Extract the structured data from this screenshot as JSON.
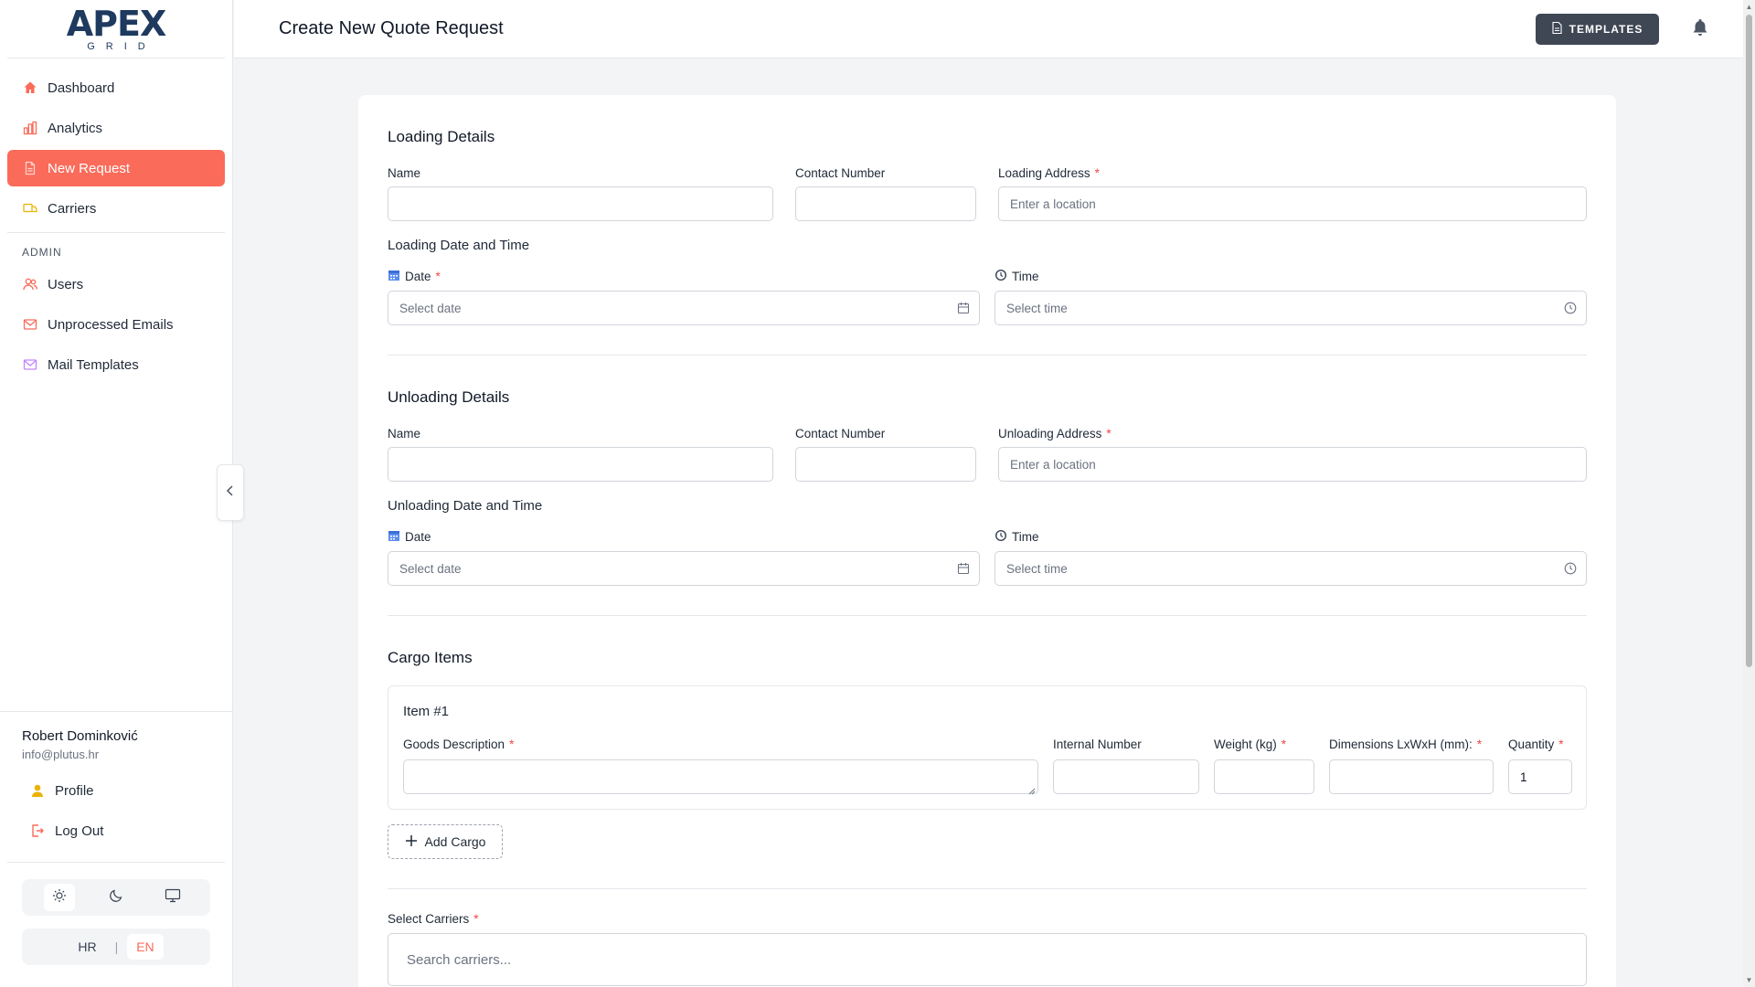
{
  "logo": {
    "main": "APEX",
    "sub": "GRID"
  },
  "nav": {
    "items": [
      {
        "label": "Dashboard",
        "icon": "home-icon"
      },
      {
        "label": "Analytics",
        "icon": "bar-chart-icon"
      },
      {
        "label": "New Request",
        "icon": "file-icon",
        "active": true
      },
      {
        "label": "Carriers",
        "icon": "truck-icon"
      }
    ],
    "admin_section": "ADMIN",
    "admin_items": [
      {
        "label": "Users",
        "icon": "users-icon"
      },
      {
        "label": "Unprocessed Emails",
        "icon": "mail-icon"
      },
      {
        "label": "Mail Templates",
        "icon": "mail-template-icon"
      }
    ]
  },
  "user": {
    "name": "Robert Dominković",
    "email": "info@plutus.hr"
  },
  "user_nav": {
    "profile": "Profile",
    "logout": "Log Out"
  },
  "lang": {
    "hr": "HR",
    "sep": "|",
    "en": "EN",
    "active": "EN"
  },
  "header": {
    "title": "Create New Quote Request",
    "templates_label": "TEMPLATES"
  },
  "loading": {
    "title": "Loading Details",
    "name_label": "Name",
    "contact_label": "Contact Number",
    "address_label": "Loading Address",
    "address_placeholder": "Enter a location",
    "datetime_title": "Loading Date and Time",
    "date_label": "Date",
    "date_placeholder": "Select date",
    "time_label": "Time",
    "time_placeholder": "Select time"
  },
  "unloading": {
    "title": "Unloading Details",
    "name_label": "Name",
    "contact_label": "Contact Number",
    "address_label": "Unloading Address",
    "address_placeholder": "Enter a location",
    "datetime_title": "Unloading Date and Time",
    "date_label": "Date",
    "date_placeholder": "Select date",
    "time_label": "Time",
    "time_placeholder": "Select time"
  },
  "cargo": {
    "title": "Cargo Items",
    "item_title": "Item #1",
    "goods_label": "Goods Description",
    "internal_label": "Internal Number",
    "weight_label": "Weight (kg)",
    "dimensions_label": "Dimensions LxWxH (mm):",
    "quantity_label": "Quantity",
    "quantity_value": "1",
    "add_label": "Add Cargo"
  },
  "carriers": {
    "label": "Select Carriers",
    "placeholder": "Search carriers..."
  },
  "required_mark": "*",
  "colors": {
    "accent": "#fa6b5a",
    "dark_button": "#3f4654",
    "required": "#ef4444"
  }
}
